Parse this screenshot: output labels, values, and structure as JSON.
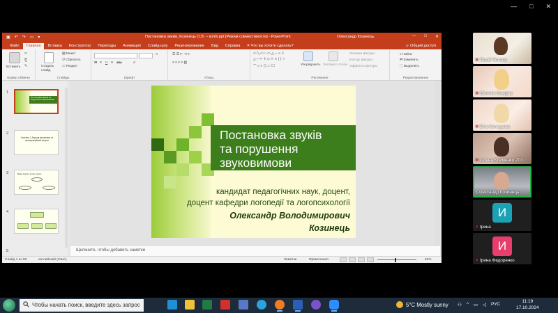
{
  "zoom": {
    "controls": [
      "—",
      "□",
      "✕"
    ]
  },
  "powerpoint": {
    "window_title": "Постановка звуків_Козинець О.В. – копія.ppt [Режим совместимости] - PowerPoint",
    "user": "Олександр Козинець",
    "qat_icons": [
      "save-icon",
      "undo-icon",
      "redo-icon",
      "present-icon",
      "customize-icon"
    ],
    "window_buttons": [
      "—",
      "□",
      "✕"
    ],
    "tabs": [
      {
        "label": "Файл",
        "active": false
      },
      {
        "label": "Главная",
        "active": true
      },
      {
        "label": "Вставка",
        "active": false
      },
      {
        "label": "Конструктор",
        "active": false
      },
      {
        "label": "Переходы",
        "active": false
      },
      {
        "label": "Анимация",
        "active": false
      },
      {
        "label": "Слайд-шоу",
        "active": false
      },
      {
        "label": "Рецензирование",
        "active": false
      },
      {
        "label": "Вид",
        "active": false
      },
      {
        "label": "Справка",
        "active": false
      }
    ],
    "tell_me": "Что вы хотите сделать?",
    "share": "Общий доступ",
    "ribbon": {
      "groups": {
        "clipboard": "Буфер обмена",
        "slides": "Слайды",
        "font": "Шрифт",
        "paragraph": "Абзац",
        "drawing": "Рисование",
        "editing": "Редактирование"
      },
      "paste": "Вставить",
      "new_slide": "Создать слайд",
      "layout": "Макет",
      "reset": "Сбросить",
      "section": "Раздел",
      "arrange": "Упорядочить",
      "quick_styles": "Экспресс-стили",
      "shape_fill": "Заливка фигуры",
      "shape_outline": "Контур фигуры",
      "shape_effects": "Эффекты фигуры",
      "find": "Найти",
      "replace": "Заменить",
      "select": "Выделить"
    },
    "thumbnails": [
      {
        "num": "1",
        "text": "Постановка звуків та порушення звуковимови"
      },
      {
        "num": "2",
        "text": "Частина I. Звукові механізми та артикуляційний апарат"
      },
      {
        "num": "3",
        "text": "Види звуків: як ми чуємо"
      },
      {
        "num": "4",
        "text": ""
      },
      {
        "num": "5",
        "text": ""
      }
    ],
    "slide": {
      "title_lines": [
        "Постановка звуків",
        "та порушення",
        "звуковимови"
      ],
      "subtitle_line1": "кандидат педагогічних наук, доцент,",
      "subtitle_line2": "доцент кафедри логопедії та логопсихології",
      "author_line1": "Олександр Володимирович",
      "author_line2": "Козинець"
    },
    "notes_placeholder": "Щелкните, чтобы добавить заметки",
    "status": {
      "slide_counter": "Слайд 1 из 50",
      "language": "английский (США)",
      "notes": "Заметки",
      "comments": "Примечания",
      "zoom_percent": "62%",
      "zoom_level": 0.62
    }
  },
  "participants": [
    {
      "name": "Палій Тетяна",
      "type": "video",
      "speaking": false,
      "muted": true
    },
    {
      "name": "Євгенія Линдіна",
      "type": "video",
      "speaking": false,
      "muted": true
    },
    {
      "name": "Віта Колодкіна",
      "type": "video",
      "speaking": false,
      "muted": true
    },
    {
      "name": "Олена Клименко 203",
      "type": "video",
      "speaking": false,
      "muted": true
    },
    {
      "name": "Олександр Козинець",
      "type": "video",
      "speaking": true,
      "muted": false
    },
    {
      "name": "Ірина",
      "type": "avatar",
      "initial": "И",
      "color": "#1ba3b5",
      "speaking": false,
      "muted": true
    },
    {
      "name": "Ірина Федоренко",
      "type": "avatar",
      "initial": "И",
      "color": "#e83e6c",
      "speaking": false,
      "muted": true
    }
  ],
  "taskbar": {
    "search_placeholder": "Чтобы начать поиск, введите здесь запрос",
    "apps": [
      {
        "name": "app-icon-1",
        "color": "#1f8fd6"
      },
      {
        "name": "file-explorer-icon",
        "color": "#f0c23a"
      },
      {
        "name": "excel-icon",
        "color": "#1f7a45"
      },
      {
        "name": "acrobat-icon",
        "color": "#d2302a"
      },
      {
        "name": "save-app-icon",
        "color": "#5a78c8"
      },
      {
        "name": "telegram-icon",
        "color": "#2aa3de"
      },
      {
        "name": "firefox-icon",
        "color": "#f07b20"
      },
      {
        "name": "word-icon",
        "color": "#2b5fb4"
      },
      {
        "name": "viber-icon",
        "color": "#7b52c8"
      },
      {
        "name": "zoom-app-icon",
        "color": "#2d8cff"
      }
    ],
    "weather": "5°C  Mostly sunny",
    "tray_language": "РУС",
    "time": "11:19",
    "date": "17.10.2024"
  }
}
